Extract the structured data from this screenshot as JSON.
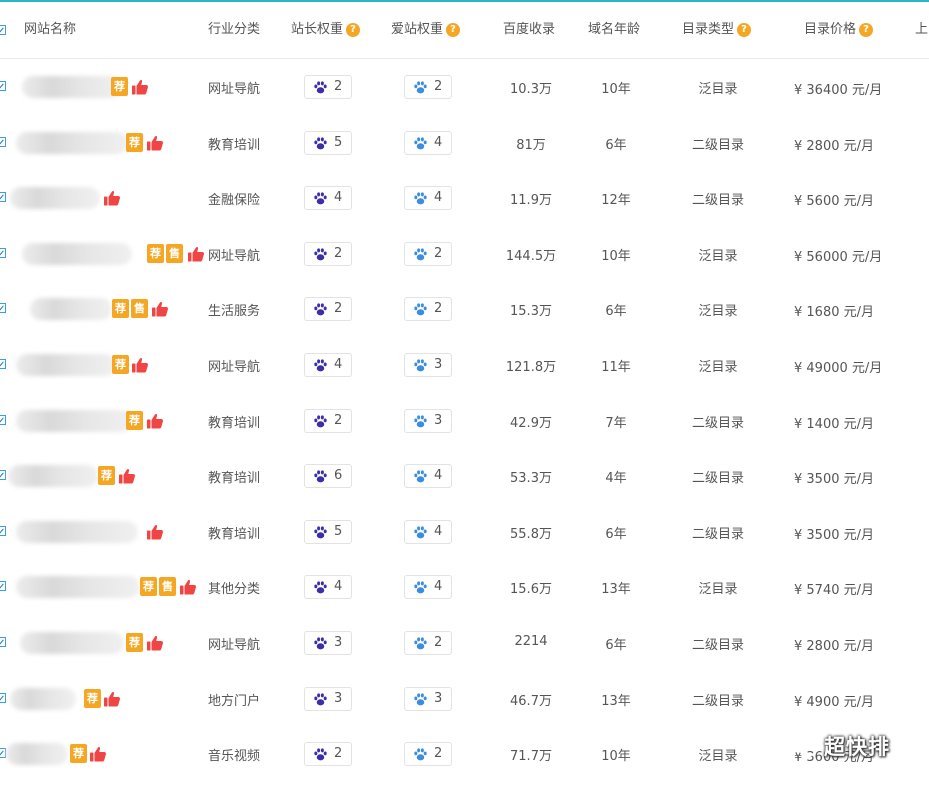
{
  "header": {
    "name": "网站名称",
    "category": "行业分类",
    "zz_weight": "站长权重",
    "az_weight": "爱站权重",
    "baidu_index": "百度收录",
    "domain_age": "域名年龄",
    "dir_type": "目录类型",
    "dir_price": "目录价格",
    "extra": "上",
    "help_mark": "?"
  },
  "badges": {
    "rec": "荐",
    "sale": "售"
  },
  "colors": {
    "accent_line": "#2bb6c4",
    "badge": "#f5a623",
    "thumb": "#f04545",
    "paw_zz": "#3b2fa8",
    "paw_az": "#3b8de0"
  },
  "icons": {
    "paw": "paw-icon",
    "thumb": "thumbs-up-icon",
    "checkbox": "checkbox-icon"
  },
  "rows": [
    {
      "category": "网址导航",
      "zz": "2",
      "az": "2",
      "baidu": "10.3万",
      "age": "10年",
      "type": "泛目录",
      "price": "¥ 36400 元/月"
    },
    {
      "category": "教育培训",
      "zz": "5",
      "az": "4",
      "baidu": "81万",
      "age": "6年",
      "type": "二级目录",
      "price": "¥ 2800 元/月"
    },
    {
      "category": "金融保险",
      "zz": "4",
      "az": "4",
      "baidu": "11.9万",
      "age": "12年",
      "type": "二级目录",
      "price": "¥ 5600 元/月"
    },
    {
      "category": "网址导航",
      "zz": "2",
      "az": "2",
      "baidu": "144.5万",
      "age": "10年",
      "type": "泛目录",
      "price": "¥ 56000 元/月"
    },
    {
      "category": "生活服务",
      "zz": "2",
      "az": "2",
      "baidu": "15.3万",
      "age": "6年",
      "type": "泛目录",
      "price": "¥ 1680 元/月"
    },
    {
      "category": "网址导航",
      "zz": "4",
      "az": "3",
      "baidu": "121.8万",
      "age": "11年",
      "type": "泛目录",
      "price": "¥ 49000 元/月"
    },
    {
      "category": "教育培训",
      "zz": "2",
      "az": "3",
      "baidu": "42.9万",
      "age": "7年",
      "type": "二级目录",
      "price": "¥ 1400 元/月"
    },
    {
      "category": "教育培训",
      "zz": "6",
      "az": "4",
      "baidu": "53.3万",
      "age": "4年",
      "type": "二级目录",
      "price": "¥ 3500 元/月"
    },
    {
      "category": "教育培训",
      "zz": "5",
      "az": "4",
      "baidu": "55.8万",
      "age": "6年",
      "type": "二级目录",
      "price": "¥ 3500 元/月"
    },
    {
      "category": "其他分类",
      "zz": "4",
      "az": "4",
      "baidu": "15.6万",
      "age": "13年",
      "type": "泛目录",
      "price": "¥ 5740 元/月"
    },
    {
      "category": "网址导航",
      "zz": "3",
      "az": "2",
      "baidu": "2214",
      "age": "6年",
      "type": "二级目录",
      "price": "¥ 2800 元/月"
    },
    {
      "category": "地方门户",
      "zz": "3",
      "az": "3",
      "baidu": "46.7万",
      "age": "13年",
      "type": "二级目录",
      "price": "¥ 4900 元/月"
    },
    {
      "category": "音乐视频",
      "zz": "2",
      "az": "2",
      "baidu": "71.7万",
      "age": "10年",
      "type": "泛目录",
      "price": "¥ 3600 元/月"
    }
  ],
  "watermark": {
    "text": "超快排",
    "icon": "wechat-icon"
  }
}
